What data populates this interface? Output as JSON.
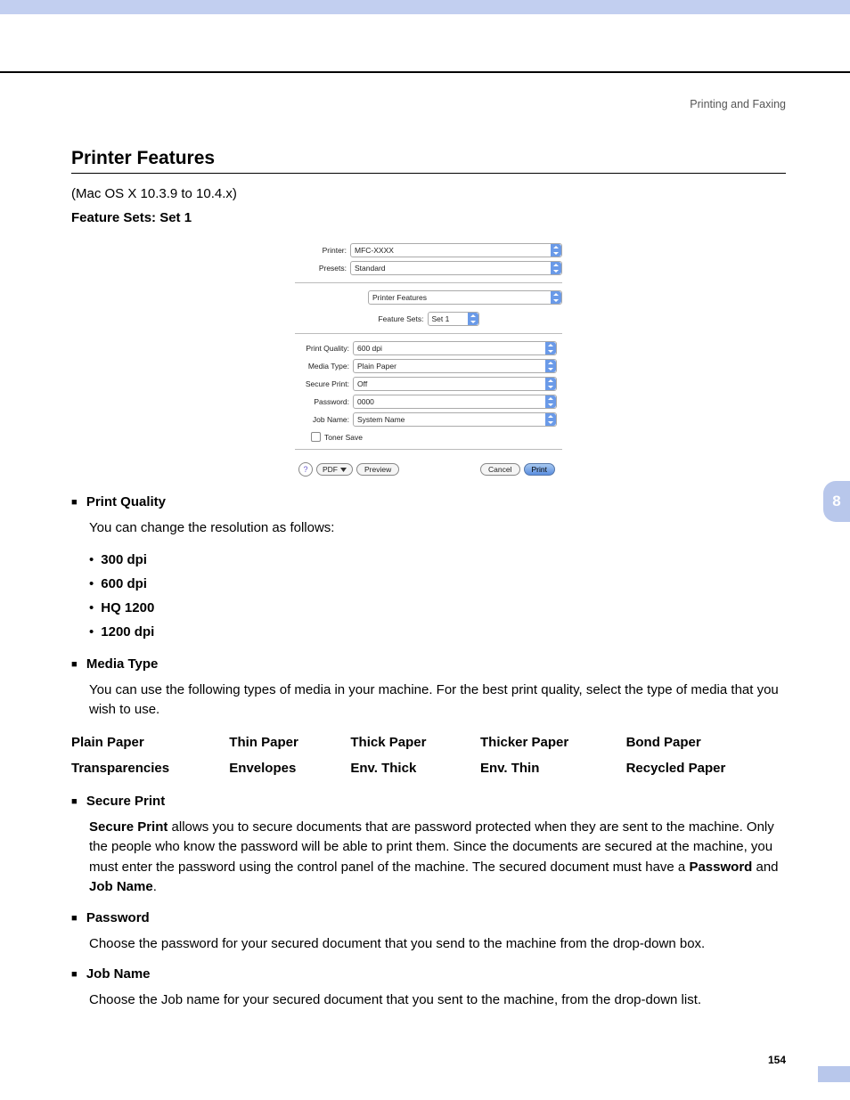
{
  "header": {
    "section": "Printing and Faxing"
  },
  "title": "Printer Features",
  "oscaption": "(Mac OS X 10.3.9 to 10.4.x)",
  "featureSetLabel": "Feature Sets: Set 1",
  "dialog": {
    "printerLabel": "Printer:",
    "printerValue": "MFC-XXXX",
    "presetsLabel": "Presets:",
    "presetsValue": "Standard",
    "paneValue": "Printer Features",
    "featureSetsLabel": "Feature Sets:",
    "featureSetsValue": "Set 1",
    "pqLabel": "Print Quality:",
    "pqValue": "600 dpi",
    "mtLabel": "Media Type:",
    "mtValue": "Plain Paper",
    "spLabel": "Secure Print:",
    "spValue": "Off",
    "pwLabel": "Password:",
    "pwValue": "0000",
    "jnLabel": "Job Name:",
    "jnValue": "System Name",
    "tonerSave": "Toner Save",
    "help": "?",
    "pdf": "PDF",
    "preview": "Preview",
    "cancel": "Cancel",
    "print": "Print"
  },
  "sections": {
    "pq": {
      "head": "Print Quality",
      "body": "You can change the resolution as follows:",
      "items": [
        "300 dpi",
        "600 dpi",
        "HQ 1200",
        "1200 dpi"
      ]
    },
    "mt": {
      "head": "Media Type",
      "body": "You can use the following types of media in your machine. For the best print quality, select the type of media that you wish to use.",
      "grid": [
        [
          "Plain Paper",
          "Thin Paper",
          "Thick Paper",
          "Thicker Paper",
          "Bond Paper"
        ],
        [
          "Transparencies",
          "Envelopes",
          "Env. Thick",
          "Env. Thin",
          "Recycled Paper"
        ]
      ]
    },
    "sp": {
      "head": "Secure Print",
      "boldLead": "Secure Print",
      "body1": " allows you to secure documents that are password protected when they are sent to the machine. Only the people who know the password will be able to print them. Since the documents are secured at the machine, you must enter the password using the control panel of the machine. The secured document must have a ",
      "bold2": "Password",
      "and": " and ",
      "bold3": "Job Name",
      "period": "."
    },
    "pw": {
      "head": "Password",
      "body": "Choose the password for your secured document that you send to the machine from the drop-down box."
    },
    "jn": {
      "head": "Job Name",
      "body": "Choose the Job name for your secured document that you sent to the machine, from the drop-down list."
    }
  },
  "tab": "8",
  "pageNum": "154"
}
